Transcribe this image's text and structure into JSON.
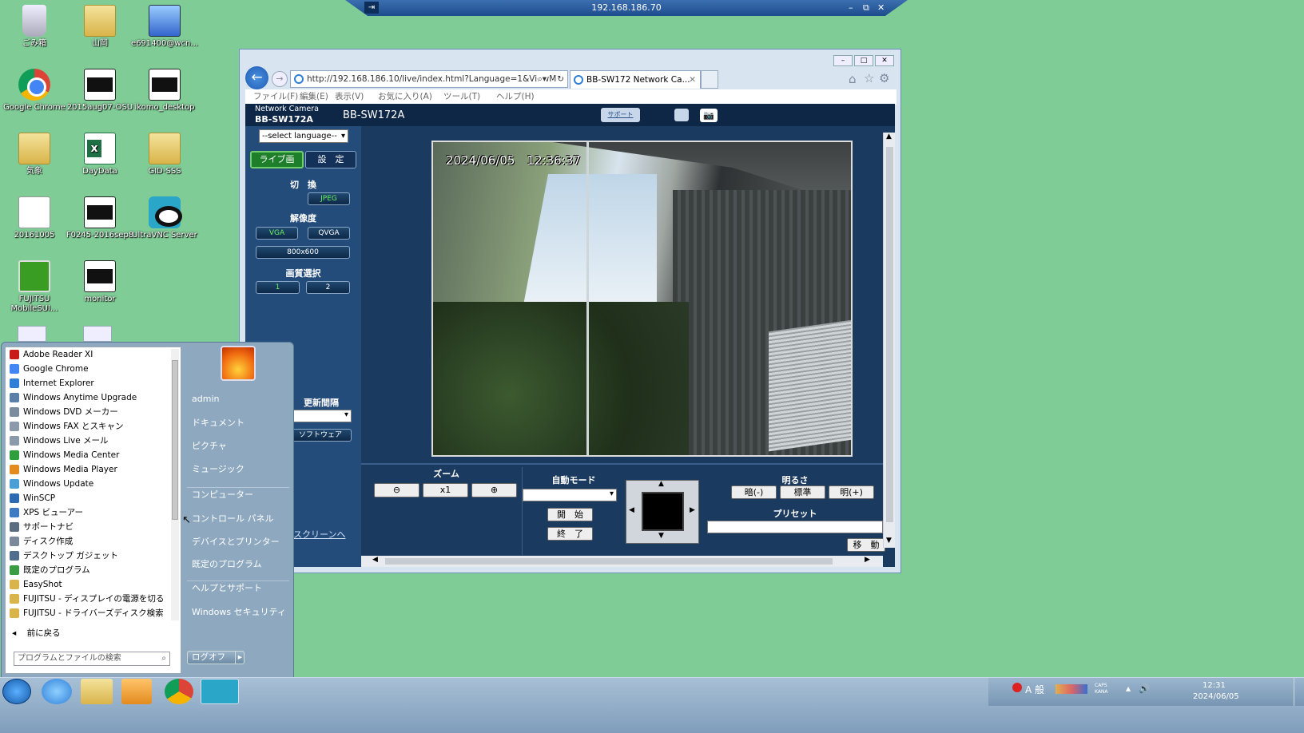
{
  "remote_bar": {
    "title": "192.168.186.70"
  },
  "desktop": {
    "icons": [
      {
        "label": "ごみ箱",
        "icon": "recycle-bin-icon"
      },
      {
        "label": "山岡",
        "icon": "folder-icon"
      },
      {
        "label": "e691400@wcn...",
        "icon": "network-pc-icon"
      },
      {
        "label": "Google Chrome",
        "icon": "chrome-icon"
      },
      {
        "label": "2015aug07-OSU",
        "icon": "image-file-icon"
      },
      {
        "label": "ikomo_desktop",
        "icon": "image-file-icon"
      },
      {
        "label": "気象",
        "icon": "folder-icon"
      },
      {
        "label": "DayData",
        "icon": "excel-icon"
      },
      {
        "label": "GID-SSS",
        "icon": "folder-icon"
      },
      {
        "label": "20161005",
        "icon": "text-file-icon"
      },
      {
        "label": "F0245-2016sep8",
        "icon": "image-file-icon"
      },
      {
        "label": "UltraVNC Server",
        "icon": "ultravnc-icon"
      },
      {
        "label": "FUJITSU MobileSUI...",
        "icon": "fujitsu-icon"
      },
      {
        "label": "monitor",
        "icon": "image-file-icon"
      }
    ]
  },
  "browser": {
    "url": "http://192.168.186.10/live/index.html?Language=1&ViewM",
    "tab_title": "BB-SW172 Network Ca...",
    "menu": [
      "ファイル(F)",
      "編集(E)",
      "表示(V)",
      "お気に入り(A)",
      "ツール(T)",
      "ヘルプ(H)"
    ]
  },
  "camera": {
    "brand_small": "Network Camera",
    "model": "BB-SW172A",
    "model_title": "BB-SW172A",
    "support": "サポート",
    "language_select": "--select language--",
    "tab_live": "ライブ画",
    "tab_settings": "設　定",
    "switch_title": "切　換",
    "jpeg": "JPEG",
    "resolution_title": "解像度",
    "vga": "VGA",
    "qvga": "QVGA",
    "res_800": "800x600",
    "quality_title": "画質選択",
    "q1": "1",
    "q2": "2",
    "refresh_title": "更新間隔",
    "software": "ソフトウェア",
    "fullscreen": "スクリーンへ",
    "timestamp": "2024/06/05　12:36:37",
    "zoom_title": "ズーム",
    "zoom_x1": "x1",
    "auto_title": "自動モード",
    "start": "開　始",
    "stop": "終　了",
    "brightness_title": "明るさ",
    "dark": "暗(-)",
    "standard": "標準",
    "bright": "明(+)",
    "preset_title": "プリセット",
    "move": "移　動"
  },
  "start_menu": {
    "programs": [
      {
        "label": "Adobe Reader XI",
        "color": "#c91a1a"
      },
      {
        "label": "Google Chrome",
        "color": "#4285f4"
      },
      {
        "label": "Internet Explorer",
        "color": "#2f7fd8"
      },
      {
        "label": "Windows Anytime Upgrade",
        "color": "#5a7fa8"
      },
      {
        "label": "Windows DVD メーカー",
        "color": "#7a8c9e"
      },
      {
        "label": "Windows FAX とスキャン",
        "color": "#8a9aab"
      },
      {
        "label": "Windows Live メール",
        "color": "#8a9aab"
      },
      {
        "label": "Windows Media Center",
        "color": "#2f9e3f"
      },
      {
        "label": "Windows Media Player",
        "color": "#e38b1e"
      },
      {
        "label": "Windows Update",
        "color": "#4aa0d6"
      },
      {
        "label": "WinSCP",
        "color": "#2d6ab1"
      },
      {
        "label": "XPS ビューアー",
        "color": "#3f7bc2"
      },
      {
        "label": "サポートナビ",
        "color": "#5b6d80"
      },
      {
        "label": "ディスク作成",
        "color": "#7a8a9a"
      },
      {
        "label": "デスクトップ ガジェット",
        "color": "#4f6f8f"
      },
      {
        "label": "既定のプログラム",
        "color": "#3a9d43"
      },
      {
        "label": "EasyShot",
        "color": "#d8b44a"
      },
      {
        "label": "FUJITSU - ディスプレイの電源を切る",
        "color": "#d8b44a"
      },
      {
        "label": "FUJITSU - ドライバーズディスク検索",
        "color": "#d8b44a"
      }
    ],
    "back": "前に戻る",
    "search_placeholder": "プログラムとファイルの検索",
    "right_items": [
      "admin",
      "ドキュメント",
      "ピクチャ",
      "ミュージック",
      "コンピューター",
      "コントロール パネル",
      "デバイスとプリンター",
      "既定のプログラム",
      "ヘルプとサポート",
      "Windows セキュリティ"
    ],
    "logoff": "ログオフ"
  },
  "taskbar": {
    "ime": "A 般",
    "caps": "CAPS",
    "kana": "KANA",
    "time": "12:31",
    "date": "2024/06/05"
  }
}
